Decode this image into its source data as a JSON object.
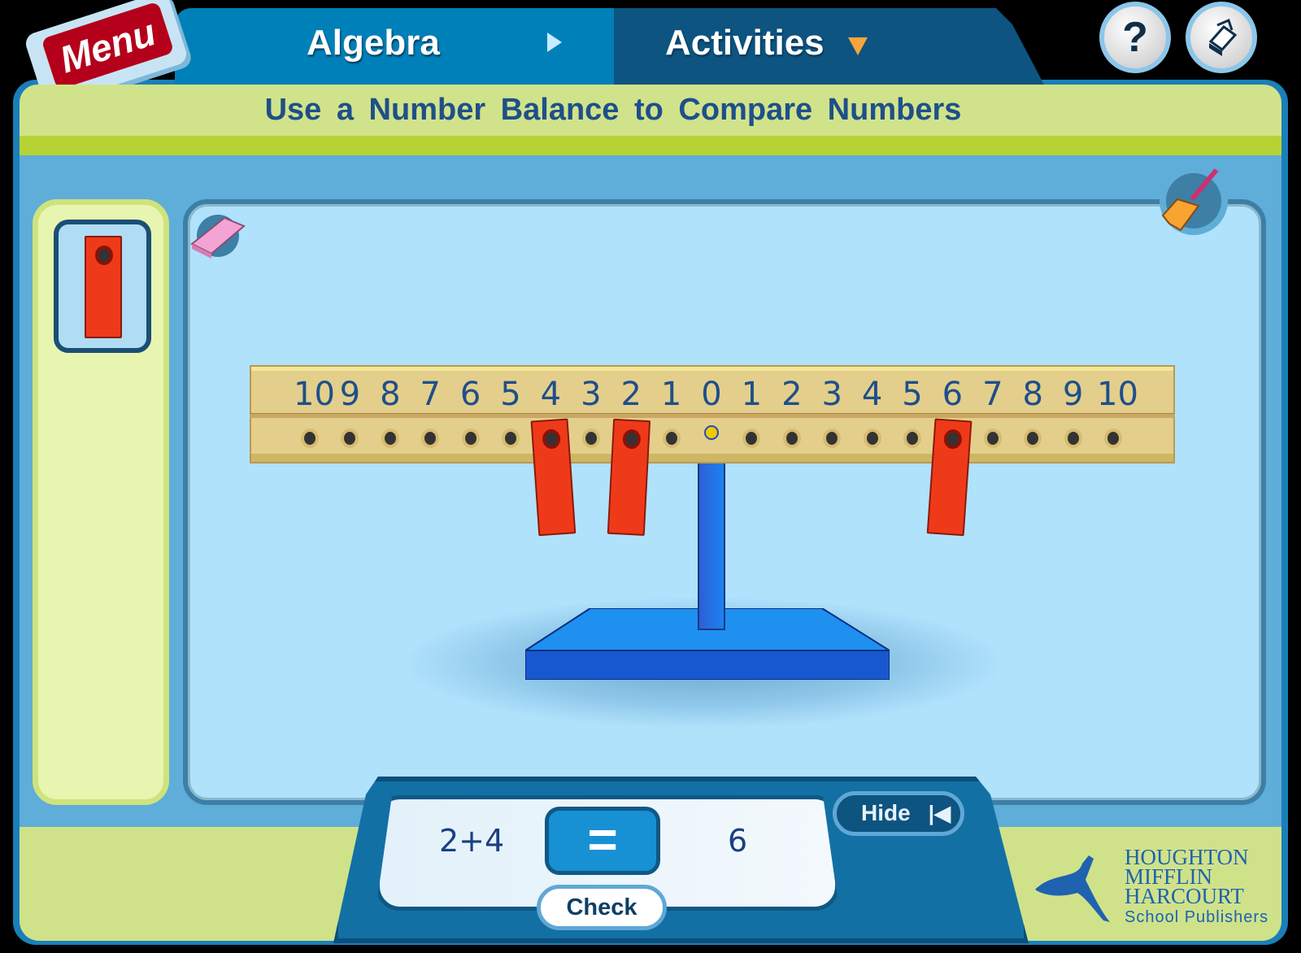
{
  "nav": {
    "menu_label": "Menu",
    "breadcrumb": "Algebra",
    "current": "Activities",
    "help_label": "?"
  },
  "title": "Use a Number Balance to Compare Numbers",
  "beam": {
    "labels_left": [
      "10",
      "9",
      "8",
      "7",
      "6",
      "5",
      "4",
      "3",
      "2",
      "1"
    ],
    "center": "0",
    "labels_right": [
      "1",
      "2",
      "3",
      "4",
      "5",
      "6",
      "7",
      "8",
      "9",
      "10"
    ]
  },
  "weights": [
    {
      "side": "left",
      "position": 4
    },
    {
      "side": "left",
      "position": 2
    },
    {
      "side": "right",
      "position": 6
    }
  ],
  "equation": {
    "left": "2+4",
    "relation": "=",
    "right": "6",
    "check_label": "Check",
    "hide_label": "Hide"
  },
  "logo": {
    "lines": [
      "HOUGHTON",
      "MIFFLIN",
      "HARCOURT"
    ],
    "sub": "School Publishers"
  },
  "colors": {
    "weight": "#ef3a1a",
    "stand": "#1c82f0",
    "beam": "#e3cf8b",
    "accent": "#1370a4"
  },
  "icons": {
    "eraser": "eraser-icon",
    "broom": "broom-icon",
    "print": "print-icon",
    "help": "help-icon"
  }
}
